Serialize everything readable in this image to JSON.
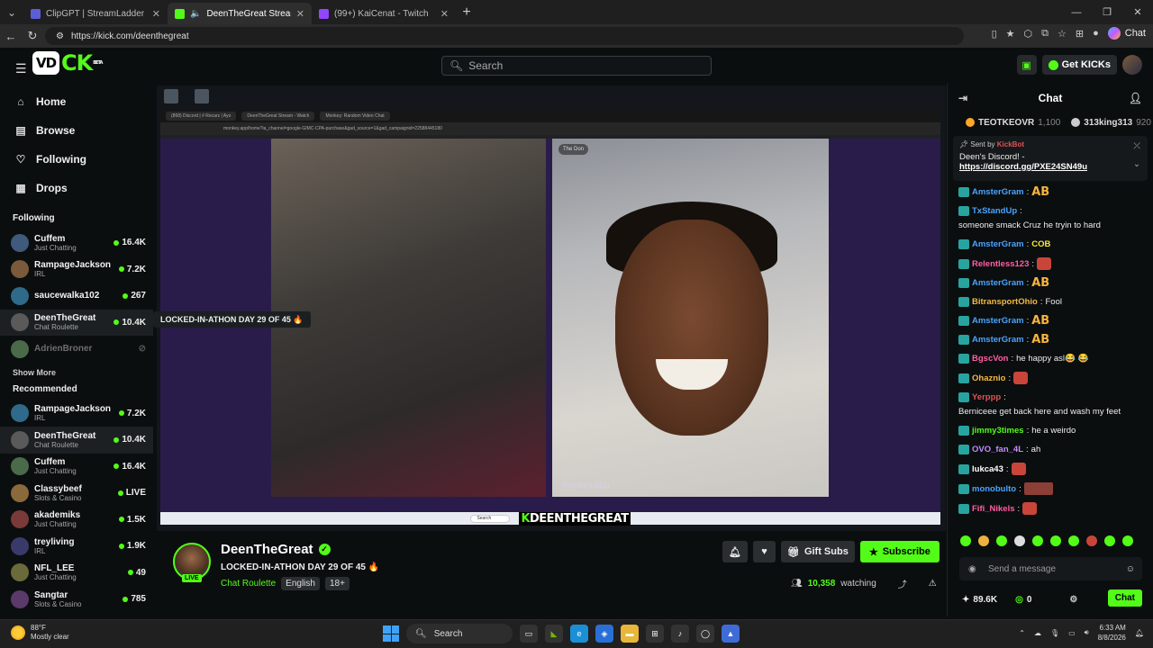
{
  "browser": {
    "tabs": [
      {
        "title": "ClipGPT | StreamLadder",
        "color": "#5b5fd6"
      },
      {
        "title": "DeenTheGreat Stream - Watch",
        "color": "#53fc18"
      },
      {
        "title": "(99+) KaiCenat - Twitch",
        "color": "#9146ff"
      }
    ],
    "url": "https://kick.com/deenthegreat",
    "chat_label": "Chat"
  },
  "header": {
    "logo_box": "VD",
    "logo_text": "CK",
    "logo_beta": "BETA",
    "search_placeholder": "Search",
    "get_kicks": "Get KICKs"
  },
  "sidebar": {
    "nav": [
      {
        "label": "Home",
        "icon": "home-icon"
      },
      {
        "label": "Browse",
        "icon": "browse-icon"
      },
      {
        "label": "Following",
        "icon": "heart-icon"
      },
      {
        "label": "Drops",
        "icon": "drops-icon"
      }
    ],
    "following_title": "Following",
    "following": [
      {
        "name": "Cuffem",
        "category": "Just Chatting",
        "viewers": "16.4K"
      },
      {
        "name": "RampageJackson",
        "category": "IRL",
        "viewers": "7.2K"
      },
      {
        "name": "saucewalka102",
        "category": "",
        "viewers": "267"
      },
      {
        "name": "DeenTheGreat",
        "category": "Chat Roulette",
        "viewers": "10.4K"
      },
      {
        "name": "AdrienBroner",
        "category": "",
        "viewers": ""
      }
    ],
    "show_more": "Show More",
    "recommended_title": "Recommended",
    "recommended": [
      {
        "name": "RampageJackson",
        "category": "IRL",
        "viewers": "7.2K"
      },
      {
        "name": "DeenTheGreat",
        "category": "Chat Roulette",
        "viewers": "10.4K"
      },
      {
        "name": "Cuffem",
        "category": "Just Chatting",
        "viewers": "16.4K"
      },
      {
        "name": "Classybeef",
        "category": "Slots & Casino",
        "viewers": "LIVE"
      },
      {
        "name": "akademiks",
        "category": "Just Chatting",
        "viewers": "1.5K"
      },
      {
        "name": "treyliving",
        "category": "IRL",
        "viewers": "1.9K"
      },
      {
        "name": "NFL_LEE",
        "category": "Just Chatting",
        "viewers": "49"
      },
      {
        "name": "Sangtar",
        "category": "Slots & Casino",
        "viewers": "785"
      }
    ]
  },
  "video": {
    "locked_badge": "LOCKED-IN-ATHON DAY 29 OF 45 🔥",
    "overlay_brand_k": "K",
    "overlay_brand": "DEENTHEGREAT",
    "monkey": "monkey.app",
    "the_don": "The Don",
    "inner_tabs": [
      "(868) Discord | # Recarz | Ayo",
      "DeenTheGreat Stream - Watch",
      "Monkey: Random Video Chat"
    ],
    "inner_url": "monkey.app/home?ia_channel=google-GIMC-CPA-purchase&gad_source=1&gad_campaignid=22588445180",
    "inner_search": "Search"
  },
  "stream": {
    "name": "DeenTheGreat",
    "title": "LOCKED-IN-ATHON DAY 29 OF 45 🔥",
    "category": "Chat Roulette",
    "tags": [
      "English",
      "18+"
    ],
    "gift_subs": "Gift Subs",
    "subscribe": "Subscribe",
    "viewers": "10,358",
    "watching": "watching",
    "live": "LIVE"
  },
  "chat": {
    "title": "Chat",
    "gifters": [
      {
        "name": "TEOTKEOVR",
        "count": "1,100"
      },
      {
        "name": "313king313",
        "count": "920"
      }
    ],
    "pinned_sent_by": "Sent by",
    "pinned_user": "KickBot",
    "pinned_text": "Deen's Discord! -",
    "pinned_link": "https://discord.gg/PXE24SN49u",
    "messages": [
      {
        "user": "AmsterGram",
        "color": "#4aa3ff",
        "text": "AB",
        "type": "ab"
      },
      {
        "user": "TxStandUp",
        "color": "#4aa3ff",
        "text": "someone smack Cruz he tryin to hard",
        "type": "text"
      },
      {
        "user": "AmsterGram",
        "color": "#4aa3ff",
        "text": "COB",
        "type": "cob"
      },
      {
        "user": "Relentless123",
        "color": "#ff5fa2",
        "text": "",
        "type": "emote"
      },
      {
        "user": "AmsterGram",
        "color": "#4aa3ff",
        "text": "AB",
        "type": "ab"
      },
      {
        "user": "BitransportOhio",
        "color": "#f5b942",
        "text": "Fool",
        "type": "text"
      },
      {
        "user": "AmsterGram",
        "color": "#4aa3ff",
        "text": "AB",
        "type": "ab"
      },
      {
        "user": "AmsterGram",
        "color": "#4aa3ff",
        "text": "AB",
        "type": "ab"
      },
      {
        "user": "BgscVon",
        "color": "#ff5fa2",
        "text": "he happy asl😂 😂",
        "type": "text"
      },
      {
        "user": "Ohaznio",
        "color": "#f5b942",
        "text": "",
        "type": "emote"
      },
      {
        "user": "Yerppp",
        "color": "#e05252",
        "text": "Berniceee get back here and wash my feet",
        "type": "text"
      },
      {
        "user": "jimmy3times",
        "color": "#53fc18",
        "text": "he a weirdo",
        "type": "text"
      },
      {
        "user": "OVO_fan_4L",
        "color": "#c48cff",
        "text": "ah",
        "type": "text"
      },
      {
        "user": "lukca43",
        "color": "#ffffff",
        "text": "",
        "type": "emote"
      },
      {
        "user": "monobulto",
        "color": "#4aa3ff",
        "text": "",
        "type": "emote"
      },
      {
        "user": "Fifi_Nikels",
        "color": "#ff5fa2",
        "text": "",
        "type": "emote"
      }
    ],
    "send_placeholder": "Send a message",
    "points": "89.6K",
    "kicks": "0",
    "chat_button": "Chat"
  },
  "taskbar": {
    "temp": "88°F",
    "weather": "Mostly clear",
    "search": "Search",
    "time": "6:33 AM",
    "date": "8/8/2026"
  }
}
